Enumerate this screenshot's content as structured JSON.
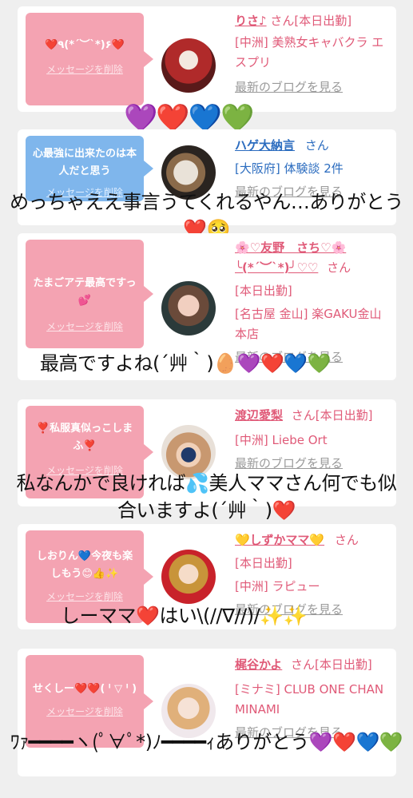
{
  "colors": {
    "pink": "#f4a3b2",
    "blue": "#7fb6ec",
    "name_pink": "#e05a78",
    "name_blue": "#2b6cbf"
  },
  "cards": [
    {
      "message": "❤️٩(*´︶`*)۶❤️",
      "delete_label": "メッセージを削除",
      "name": "りさ♪",
      "san": "さん[本日出勤]",
      "lines": [
        "[中洲] 美熟女キャバクラ エスプリ"
      ],
      "blog": "最新のブログを見る"
    },
    {
      "message": "心最強に出来たのは本人だと思う",
      "delete_label": "メッセージを削除",
      "name": "ハゲ大納言",
      "san": "さん",
      "lines": [
        "[大阪府] 体験談 2件"
      ],
      "blog": "最新のブログを見る"
    },
    {
      "message": "たまごアテ最高ですっ💕",
      "delete_label": "メッセージを削除",
      "name": "🌸♡友野　さち♡🌸",
      "name2": "╰(*´︶`*)╯♡♡",
      "san": "さん",
      "lines": [
        "[本日出勤]",
        "[名古屋 金山] 楽GAKU金山本店"
      ],
      "blog": "最新のブログを見る"
    },
    {
      "message": "❣️私服真似っこしまふ❣️",
      "delete_label": "メッセージを削除",
      "name": "渡辺愛梨",
      "san": "さん[本日出勤]",
      "lines": [
        "[中洲] Liebe Ort"
      ],
      "blog": "最新のブログを見る"
    },
    {
      "message": "しおりん💙今夜も楽しもう😊👍✨",
      "delete_label": "メッセージを削除",
      "name": "💛しずかママ💛",
      "san": "さん",
      "lines": [
        "[本日出勤]",
        "[中洲] ラピュー"
      ],
      "blog": "最新のブログを見る"
    },
    {
      "message": "せくしー❤️❤️( ˡ ▽ ˡ )",
      "delete_label": "メッセージを削除",
      "name": "梶谷かよ",
      "san": "さん[本日出勤]",
      "lines": [
        "[ミナミ] CLUB ONE CHAN MINAMI"
      ],
      "blog": "最新のブログを見る"
    }
  ],
  "overlays": {
    "hearts": "💜❤️💙💚",
    "o1": "めっちゃええ事言うてくれるやん…ありがとう❤️🥺",
    "o2": "最高ですよね(´艸｀)🥚💜❤️💙💚",
    "o3": "私なんかで良ければ💦美人ママさん何でも似合いますよ(´艸｀)❤️",
    "o4": "しーママ❤️はい\\(//∇//)/✨✨",
    "o5": "ﾜｧ━━━━ヽ(ﾟ∀ﾟ*)ﾉ━━━━ｨありがとう💜❤️💙💚"
  }
}
